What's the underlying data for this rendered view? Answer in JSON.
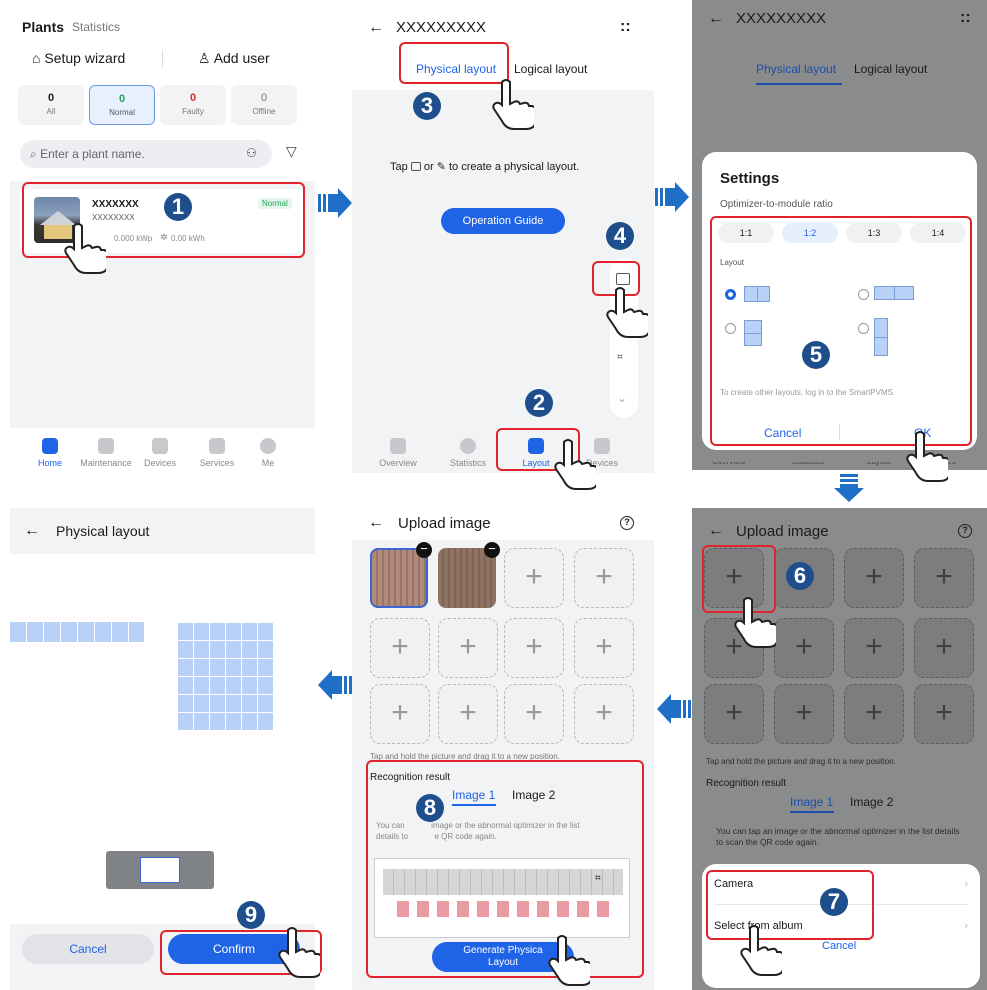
{
  "s1": {
    "title": "Plants",
    "subtitle": "Statistics",
    "setup_wizard": "Setup wizard",
    "add_user": "Add user",
    "counts": [
      {
        "value": "0",
        "label": "All"
      },
      {
        "value": "0",
        "label": "Normal"
      },
      {
        "value": "0",
        "label": "Faulty"
      },
      {
        "value": "0",
        "label": "Offline"
      }
    ],
    "search_placeholder": "Enter a plant name.",
    "plant_name": "XXXXXXX",
    "plant_sub": "XXXXXXXX",
    "plant_status": "Normal",
    "plant_kwp": "0.000 kWp",
    "plant_kwh": "0.00 kWh",
    "tabs": [
      "Home",
      "Maintenance",
      "Devices",
      "Services",
      "Me"
    ]
  },
  "s2": {
    "title": "XXXXXXXXX",
    "menu_glyph": "::",
    "tab_physical": "Physical layout",
    "tab_logical": "Logical layout",
    "hint_tap": "Tap",
    "hint_or": "or",
    "hint_end": "to create a physical layout.",
    "guide_button": "Operation Guide",
    "tabs": [
      "Overview",
      "Statistics",
      "Layout",
      "Devices"
    ]
  },
  "s3": {
    "title": "XXXXXXXXX",
    "menu_glyph": "::",
    "tab_physical": "Physical layout",
    "tab_logical": "Logical layout",
    "dialog_title": "Settings",
    "ratio_label": "Optimizer-to-module ratio",
    "ratios": [
      "1:1",
      "1:2",
      "1:3",
      "1:4"
    ],
    "layout_label": "Layout",
    "note": "To create other layouts, log in to the SmartPVMS.",
    "cancel": "Cancel",
    "ok": "OK",
    "bg_tabs": [
      "Overview",
      "Statistics",
      "Layout",
      "Devices"
    ]
  },
  "s4": {
    "title": "Physical layout",
    "cancel": "Cancel",
    "confirm": "Confirm"
  },
  "s5": {
    "title": "Upload image",
    "hint": "Tap and hold the picture and drag it to a new position.",
    "recognition": "Recognition result",
    "image_tabs": [
      "Image 1",
      "Image 2"
    ],
    "note_a": "You can",
    "note_b": "image or the abnormal optimizer in the list",
    "note_c": "details to",
    "note_d": "e QR code again.",
    "generate_line1": "Generate Physica",
    "generate_line2": "Layout"
  },
  "s6": {
    "title": "Upload image",
    "hint": "Tap and hold the picture and drag it to a new position.",
    "recognition": "Recognition result",
    "image_tabs": [
      "Image 1",
      "Image 2"
    ],
    "note": "You can tap an image or the abnormal optimizer in the list details to scan the QR code again.",
    "camera": "Camera",
    "album": "Select from album",
    "cancel": "Cancel"
  },
  "steps": [
    "1",
    "2",
    "3",
    "4",
    "5",
    "6",
    "7",
    "8",
    "9"
  ],
  "colors": {
    "accent": "#1f63e6",
    "highlight": "#e1242b",
    "step": "#1e4e8c",
    "arrow": "#1f6fc7"
  }
}
